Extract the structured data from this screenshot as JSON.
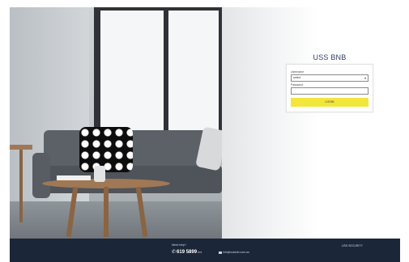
{
  "login": {
    "title": "USS BNB",
    "username_label": "Username",
    "username_value": "select",
    "password_label": "Password",
    "password_value": "",
    "login_button": "LOGIN"
  },
  "footer": {
    "help_title": "Need help?",
    "phone": "619 5899",
    "phone_suffix": "ext.",
    "email": "info@ussbnb.com.au",
    "security": "USS SECURITY"
  },
  "icons": {
    "phone": "phone-icon",
    "mail": "mail-icon",
    "select_caret": "chevron-down-icon"
  },
  "colors": {
    "login_button": "#f2e63d",
    "footer_background": "#1b2639",
    "brand_text": "#2f3f6b"
  }
}
